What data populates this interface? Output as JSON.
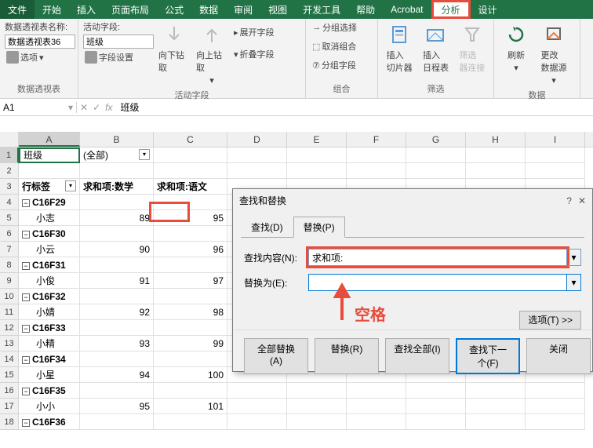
{
  "menu": {
    "file": "文件",
    "items": [
      "开始",
      "插入",
      "页面布局",
      "公式",
      "数据",
      "审阅",
      "视图",
      "开发工具",
      "帮助",
      "Acrobat",
      "分析",
      "设计"
    ],
    "activeIndex": 10
  },
  "ribbon": {
    "g1": {
      "nameLabel": "数据透视表名称:",
      "nameValue": "数据透视表36",
      "options": "选项",
      "groupLabel": "数据透视表"
    },
    "g2": {
      "activeLabel": "活动字段:",
      "activeValue": "班级",
      "fieldSettings": "字段设置",
      "drillDown": "向下钻取",
      "drillUp": "向上钻取",
      "expand": "展开字段",
      "collapse": "折叠字段",
      "groupLabel": "活动字段"
    },
    "g3": {
      "groupSelect": "分组选择",
      "ungroup": "取消组合",
      "groupField": "分组字段",
      "groupLabel": "组合"
    },
    "g4": {
      "slicer": "插入\n切片器",
      "timeline": "插入\n日程表",
      "filterConn": "筛选\n器连接",
      "groupLabel": "筛选"
    },
    "g5": {
      "refresh": "刷新",
      "changeSource": "更改\n数据源",
      "groupLabel": "数据"
    }
  },
  "formulaBar": {
    "cellRef": "A1",
    "fx": "fx",
    "value": "班级"
  },
  "columns": [
    "A",
    "B",
    "C",
    "D",
    "E",
    "F",
    "G",
    "H",
    "I"
  ],
  "pivot": {
    "filterLabel": "班级",
    "filterValue": "(全部)",
    "rowHdr": "行标签",
    "colMath": "求和项:数学",
    "colLang": "求和项:语文"
  },
  "rows": [
    {
      "n": 1,
      "a": "班级",
      "b": "(全部)",
      "type": "filter"
    },
    {
      "n": 2,
      "type": "blank"
    },
    {
      "n": 3,
      "a": "行标签",
      "b": "求和项:数学",
      "c": "求和项:语文",
      "type": "hdr"
    },
    {
      "n": 4,
      "a": "C16F29",
      "type": "group"
    },
    {
      "n": 5,
      "a": "小志",
      "b": 89,
      "c": 95
    },
    {
      "n": 6,
      "a": "C16F30",
      "type": "group"
    },
    {
      "n": 7,
      "a": "小云",
      "b": 90,
      "c": 96
    },
    {
      "n": 8,
      "a": "C16F31",
      "type": "group"
    },
    {
      "n": 9,
      "a": "小俊",
      "b": 91,
      "c": 97
    },
    {
      "n": 10,
      "a": "C16F32",
      "type": "group"
    },
    {
      "n": 11,
      "a": "小婧",
      "b": 92,
      "c": 98
    },
    {
      "n": 12,
      "a": "C16F33",
      "type": "group"
    },
    {
      "n": 13,
      "a": "小精",
      "b": 93,
      "c": 99
    },
    {
      "n": 14,
      "a": "C16F34",
      "type": "group"
    },
    {
      "n": 15,
      "a": "小星",
      "b": 94,
      "c": 100
    },
    {
      "n": 16,
      "a": "C16F35",
      "type": "group"
    },
    {
      "n": 17,
      "a": "小小",
      "b": 95,
      "c": 101
    },
    {
      "n": 18,
      "a": "C16F36",
      "type": "group"
    }
  ],
  "dialog": {
    "title": "查找和替换",
    "tabFind": "查找(D)",
    "tabReplace": "替换(P)",
    "findLabel": "查找内容(N):",
    "findValue": "求和项:",
    "replaceLabel": "替换为(E):",
    "replaceValue": "",
    "optionsBtn": "选项(T) >>",
    "btnReplaceAll": "全部替换(A)",
    "btnReplace": "替换(R)",
    "btnFindAll": "查找全部(I)",
    "btnFindNext": "查找下一个(F)",
    "btnClose": "关闭"
  },
  "annotation": {
    "spaceLabel": "空格"
  }
}
